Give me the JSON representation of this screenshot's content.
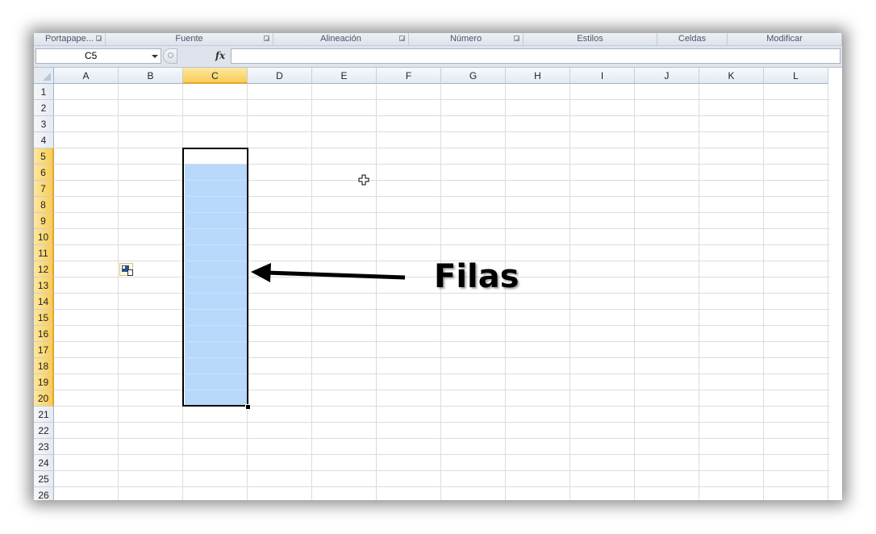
{
  "ribbon": {
    "groups": [
      {
        "label": "Portapape...",
        "launcher": true
      },
      {
        "label": "Fuente",
        "launcher": true
      },
      {
        "label": "Alineación",
        "launcher": true
      },
      {
        "label": "Número",
        "launcher": true
      },
      {
        "label": "Estilos",
        "launcher": false
      },
      {
        "label": "Celdas",
        "launcher": false
      },
      {
        "label": "Modificar",
        "launcher": false
      }
    ]
  },
  "formula_bar": {
    "name_box": "C5",
    "fx_label": "fx",
    "formula": ""
  },
  "sheet": {
    "columns": [
      "A",
      "B",
      "C",
      "D",
      "E",
      "F",
      "G",
      "H",
      "I",
      "J",
      "K",
      "L"
    ],
    "rows": [
      "1",
      "2",
      "3",
      "4",
      "5",
      "6",
      "7",
      "8",
      "9",
      "10",
      "11",
      "12",
      "13",
      "14",
      "15",
      "16",
      "17",
      "18",
      "19",
      "20",
      "21",
      "22",
      "23",
      "24",
      "25",
      "26"
    ],
    "selected_column": "C",
    "selected_rows": [
      "5",
      "6",
      "7",
      "8",
      "9",
      "10",
      "11",
      "12",
      "13",
      "14",
      "15",
      "16",
      "17",
      "18",
      "19",
      "20"
    ],
    "selection_range": "C5:C20",
    "active_cell": "C5"
  },
  "annotation": {
    "label": "Filas"
  },
  "colors": {
    "selection_fill": "#b8d8fb",
    "header_highlight": "#f9cd55",
    "gridline": "#dadcdd"
  },
  "icons": {
    "paste_options": "paste-options-icon",
    "cursor": "cell-cursor-icon",
    "arrow": "arrow-left-icon"
  }
}
